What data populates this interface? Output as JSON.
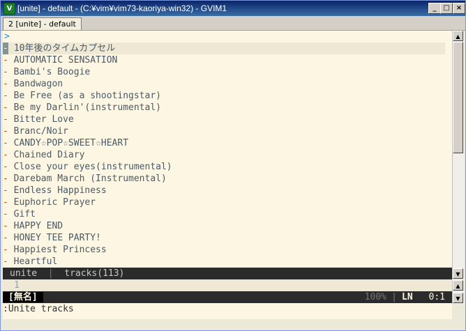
{
  "window": {
    "title": "[unite] - default - (C:¥vim¥vim73-kaoriya-win32) - GVIM1",
    "minimize_label": "_",
    "maximize_label": "□",
    "close_label": "×"
  },
  "tabline": {
    "active_tab": "2 [unite] - default"
  },
  "unite": {
    "prompt": ">",
    "current_item": "10年後のタイムカプセル",
    "items": [
      "AUTOMATIC SENSATION",
      "Bambi's Boogie",
      "Bandwagon",
      "Be Free (as a shootingstar)",
      "Be my Darlin'(instrumental)",
      "Bitter Love",
      "Branc/Noir",
      "CANDY☆POP☆SWEET☆HEART",
      "Chained Diary",
      "Close your eyes(instrumental)",
      "Darebam March (Instrumental)",
      "Endless Happiness",
      "Euphoric Prayer",
      "Gift",
      "HAPPY END",
      "HONEY TEE PARTY!",
      "Happiest Princess",
      "Heartful"
    ],
    "bullet": "-"
  },
  "statusline_unite": {
    "mode": "unite",
    "separator": "|",
    "source": "tracks(113)"
  },
  "lower_buffer": {
    "line_number": "1"
  },
  "statusline_noname": {
    "name": "[無名]",
    "percent": "100%",
    "separator": "|",
    "ln_label": "LN",
    "position": "0:1"
  },
  "cmdline": {
    "text": ":Unite tracks"
  },
  "colors": {
    "background": "#fdf6e3",
    "cursorline": "#eee8d5",
    "bullet": "#cb4b16",
    "statusline": "#2b2b2b"
  }
}
